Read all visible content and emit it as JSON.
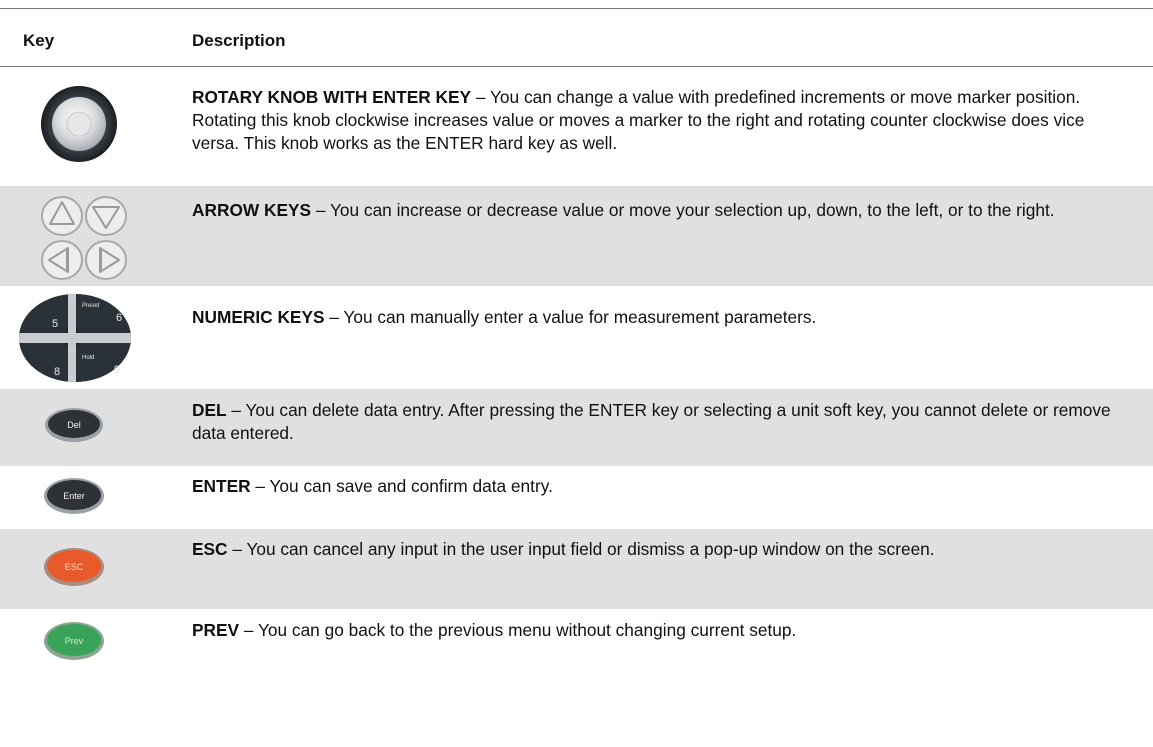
{
  "header": {
    "key_label": "Key",
    "description_label": "Description"
  },
  "rows": [
    {
      "icon": "rotary-knob-icon",
      "title": "ROTARY KNOB WITH ENTER KEY",
      "text": " – You can change a value with predefined increments or move marker position. Rotating this knob clockwise increases value or moves a marker to the right and rotating counter clockwise does vice versa. This knob works as the ENTER hard key as well."
    },
    {
      "icon": "arrow-keys-icon",
      "title": "ARROW KEYS",
      "text": " – You can increase or decrease value or move your selection up, down, to the left, or to the right."
    },
    {
      "icon": "numeric-keys-icon",
      "title": "NUMERIC KEYS",
      "text": " – You can manually enter a value for measurement parameters.",
      "key_labels": [
        "5",
        "Preset",
        "6",
        "8",
        "Hold",
        "9"
      ]
    },
    {
      "icon": "del-key-icon",
      "title": "DEL",
      "text": " – You can delete data entry. After pressing the ENTER key or selecting a unit soft key, you cannot delete or remove data entered.",
      "key_label": "Del"
    },
    {
      "icon": "enter-key-icon",
      "title": "ENTER",
      "text": " – You can save and confirm data entry.",
      "key_label": "Enter"
    },
    {
      "icon": "esc-key-icon",
      "title": "ESC",
      "text": " – You can cancel any input in the user input field or dismiss a pop-up window on the screen.",
      "key_label": "ESC"
    },
    {
      "icon": "prev-key-icon",
      "title": "PREV",
      "text": " – You can go back to the previous menu without changing current setup.",
      "key_label": "Prev"
    }
  ],
  "colors": {
    "shaded_row": "#e0e0e0",
    "esc_key": "#e85a2a",
    "prev_key": "#3aa35a",
    "dark_key": "#2e3236"
  }
}
